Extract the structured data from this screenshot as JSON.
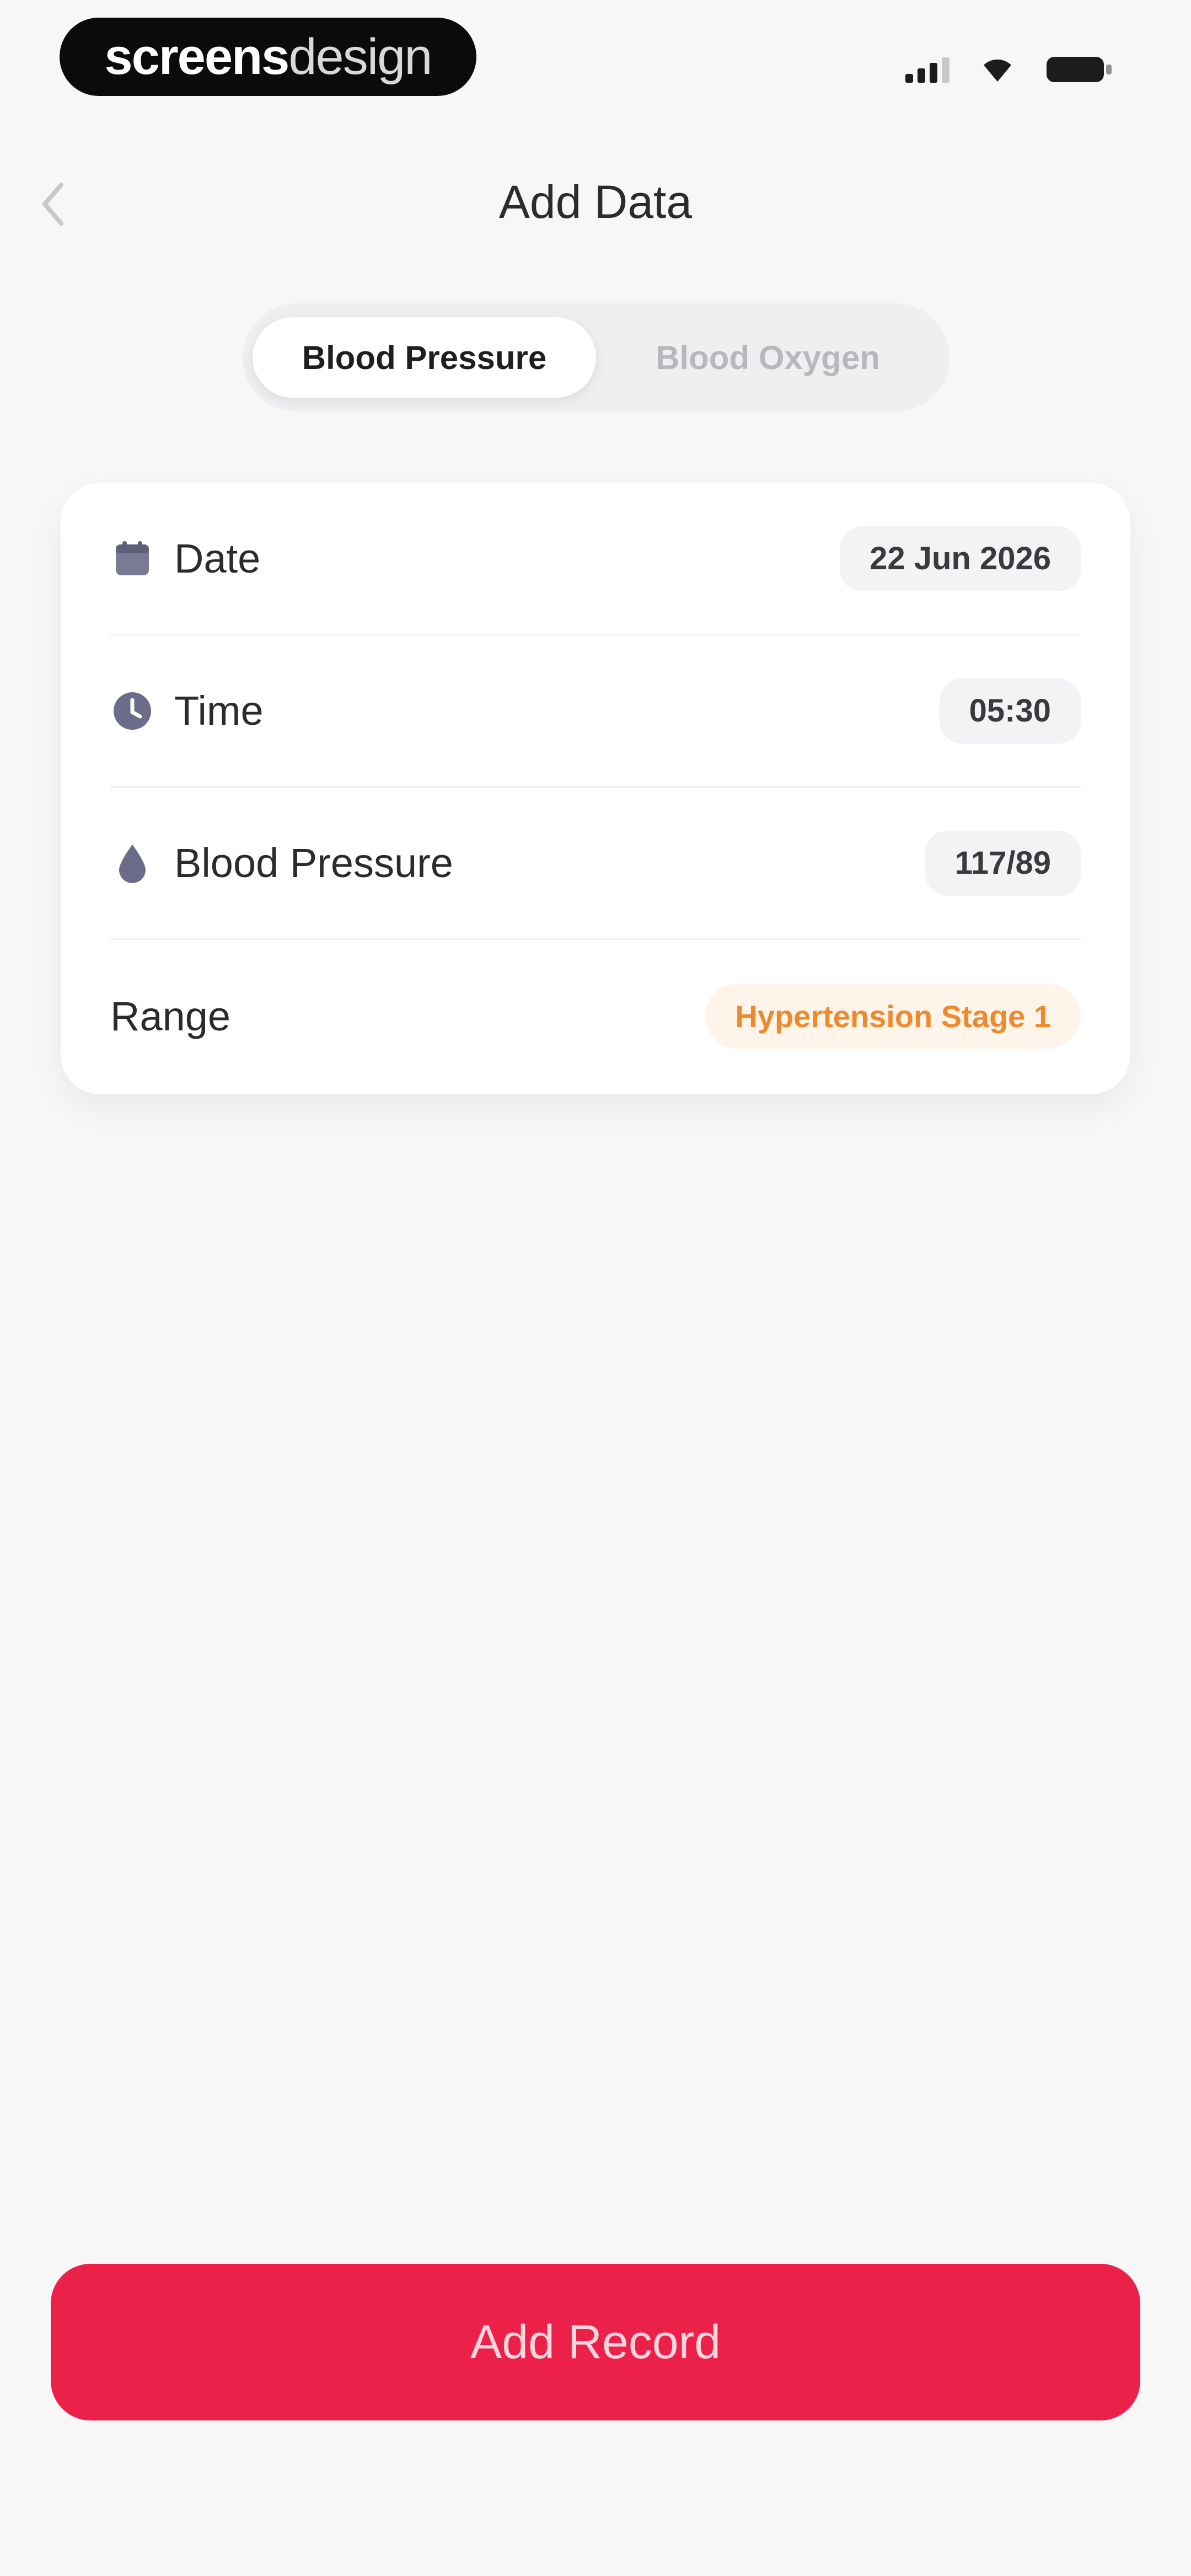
{
  "status_bar": {
    "brand_bold": "screens",
    "brand_light": "design"
  },
  "header": {
    "title": "Add Data"
  },
  "tabs": [
    {
      "label": "Blood Pressure",
      "active": true
    },
    {
      "label": "Blood Oxygen",
      "active": false
    }
  ],
  "form": {
    "rows": [
      {
        "icon": "calendar-icon",
        "label": "Date",
        "value": "22 Jun 2026"
      },
      {
        "icon": "clock-icon",
        "label": "Time",
        "value": "05:30"
      },
      {
        "icon": "blood-drop-icon",
        "label": "Blood Pressure",
        "value": "117/89"
      }
    ],
    "range": {
      "label": "Range",
      "value": "Hypertension Stage 1",
      "color": "#ee8a2e"
    }
  },
  "primary_action": {
    "label": "Add Record",
    "color": "#ec2149"
  }
}
